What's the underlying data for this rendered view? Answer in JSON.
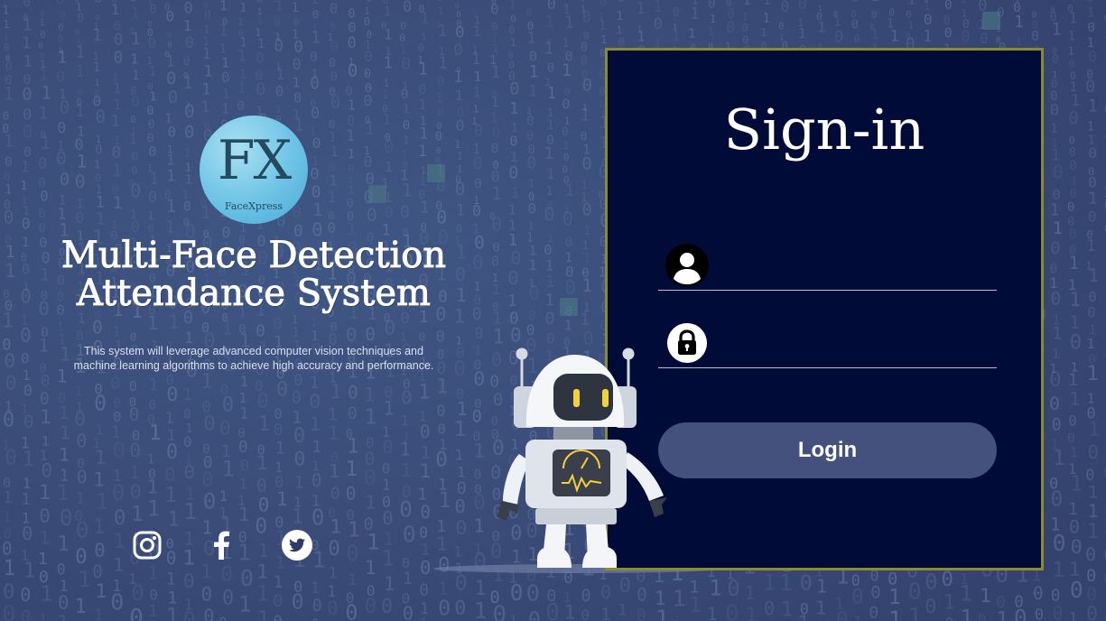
{
  "brand": {
    "logo_mark": "FX",
    "logo_name": "FaceXpress"
  },
  "hero": {
    "title_line1": "Multi-Face Detection",
    "title_line2": "Attendance System",
    "description_line1": "This system will leverage advanced computer vision techniques and",
    "description_line2": "machine learning algorithms to achieve high accuracy and performance."
  },
  "social": [
    {
      "icon": "instagram-icon"
    },
    {
      "icon": "facebook-icon"
    },
    {
      "icon": "twitter-icon"
    }
  ],
  "signin": {
    "title": "Sign-in",
    "username": {
      "icon": "user-icon",
      "value": "",
      "placeholder": ""
    },
    "password": {
      "icon": "lock-icon",
      "value": "",
      "placeholder": ""
    },
    "login_label": "Login"
  },
  "colors": {
    "background": "#3a4b78",
    "panel": "#000b38",
    "panel_border": "#8c8a34",
    "button": "#44517c",
    "accent_yellow": "#f0d23a"
  }
}
